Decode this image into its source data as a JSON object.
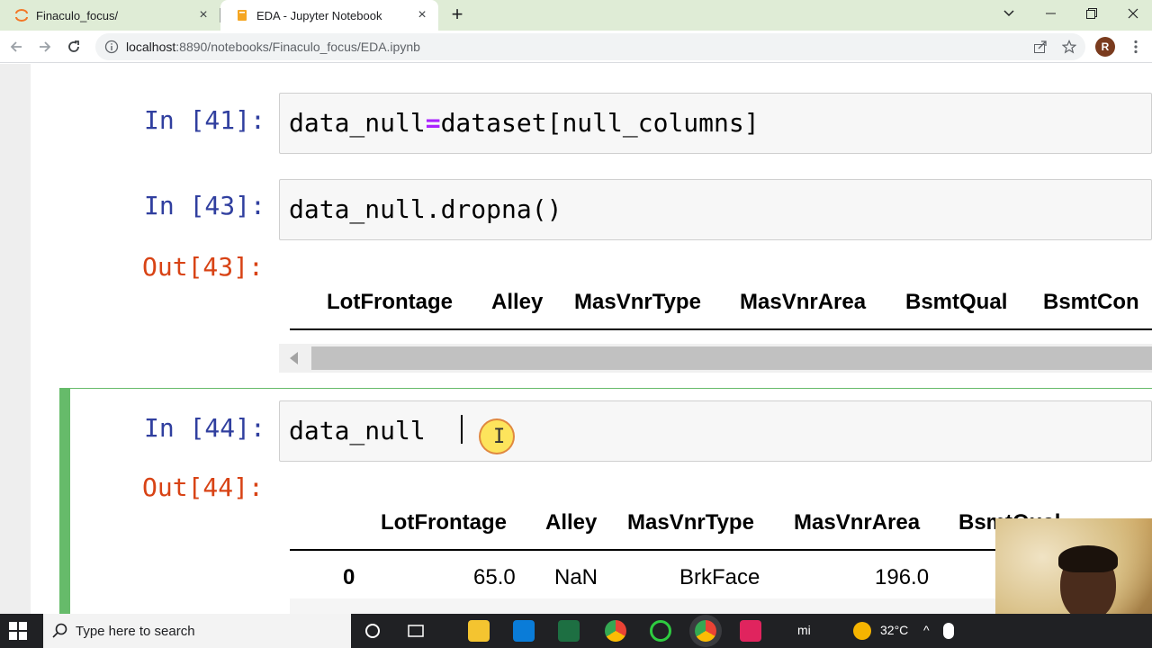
{
  "browser": {
    "tabs": [
      {
        "title": "Finaculo_focus/",
        "active": false
      },
      {
        "title": "EDA - Jupyter Notebook",
        "active": true
      }
    ],
    "new_tab_label": "+",
    "address": {
      "host": "localhost",
      "path": ":8890/notebooks/Finaculo_focus/EDA.ipynb"
    },
    "profile_initial": "R"
  },
  "notebook": {
    "cells": [
      {
        "prompt": "In [41]:",
        "code_before": "data_null",
        "operator": "=",
        "code_after": "dataset[null_columns]"
      },
      {
        "prompt": "In [43]:",
        "code": "data_null.dropna()",
        "out_prompt": "Out[43]:",
        "columns": [
          "LotFrontage",
          "Alley",
          "MasVnrType",
          "MasVnrArea",
          "BsmtQual",
          "BsmtCon"
        ]
      },
      {
        "prompt": "In [44]:",
        "code": "data_null",
        "out_prompt": "Out[44]:",
        "columns": [
          "LotFrontage",
          "Alley",
          "MasVnrType",
          "MasVnrArea",
          "BsmtQual"
        ],
        "rows": [
          {
            "index": "0",
            "values": [
              "65.0",
              "NaN",
              "BrkFace",
              "196.0"
            ]
          }
        ]
      }
    ]
  },
  "taskbar": {
    "search_placeholder": "Type here to search",
    "temperature": "32°C"
  },
  "colors": {
    "in_prompt": "#303f9f",
    "out_prompt": "#d84315",
    "selected_cell": "#66bb6a",
    "operator": "#aa22ff"
  }
}
